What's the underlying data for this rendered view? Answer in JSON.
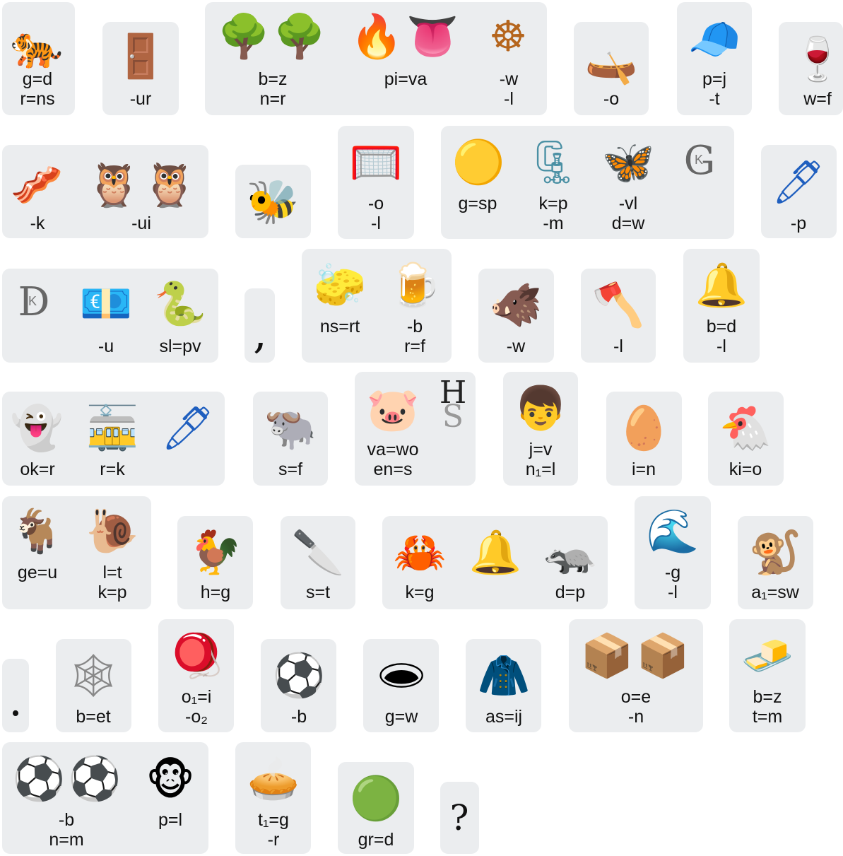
{
  "tiles": [
    {
      "glyphs": [
        {
          "icon": "tiger-icon",
          "char": "🐅"
        }
      ],
      "labels": [
        "g=d",
        "r=ns"
      ]
    },
    {
      "glyphs": [
        {
          "icon": "door-icon",
          "char": "🚪"
        }
      ],
      "labels": [
        "-ur"
      ]
    },
    {
      "glyphs": [
        {
          "icon": "tree-icon",
          "char": "🌳"
        },
        {
          "icon": "tree-icon",
          "char": "🌳"
        }
      ],
      "labels": [
        "b=z",
        "n=r"
      ]
    },
    {
      "glyphs": [
        {
          "icon": "fire-icon",
          "char": "🔥"
        },
        {
          "icon": "tongue-icon",
          "char": "👅"
        }
      ],
      "labels": [
        "pi=va"
      ]
    },
    {
      "glyphs": [
        {
          "icon": "wheel-icon",
          "char": "☸"
        }
      ],
      "labels": [
        "-w",
        "-l"
      ]
    },
    {
      "glyphs": [
        {
          "icon": "canoe-icon",
          "char": "🛶"
        }
      ],
      "labels": [
        "-o"
      ]
    },
    {
      "glyphs": [
        {
          "icon": "cap-icon",
          "char": "🧢"
        }
      ],
      "labels": [
        "p=j",
        "-t"
      ]
    },
    {
      "glyphs": [
        {
          "icon": "wine-glass-icon",
          "char": "🍷"
        }
      ],
      "labels": [
        "w=f"
      ]
    },
    {
      "glyphs": [
        {
          "icon": "bacon-icon",
          "char": "🥓"
        }
      ],
      "labels": [
        "-k"
      ]
    },
    {
      "glyphs": [
        {
          "icon": "owl-icon",
          "char": "🦉"
        },
        {
          "icon": "owl-icon",
          "char": "🦉"
        }
      ],
      "labels": [
        "-ui"
      ]
    },
    {
      "glyphs": [
        {
          "icon": "bee-icon",
          "char": "🐝"
        }
      ],
      "labels": []
    },
    {
      "glyphs": [
        {
          "icon": "goal-net-icon",
          "char": "🥅"
        }
      ],
      "labels": [
        "-o",
        "-l"
      ]
    },
    {
      "glyphs": [
        {
          "icon": "yellow-circle-icon",
          "char": "🟡"
        }
      ],
      "labels": [
        "g=sp"
      ]
    },
    {
      "glyphs": [
        {
          "icon": "clamp-icon",
          "char": "🗜"
        }
      ],
      "labels": [
        "k=p",
        "-m"
      ]
    },
    {
      "glyphs": [
        {
          "icon": "butterfly-icon",
          "char": "🦋"
        }
      ],
      "labels": [
        "-vl",
        "d=w"
      ]
    },
    {
      "glyphs": [
        {
          "icon": "letter-g-icon",
          "char": "G",
          "sub": "K"
        }
      ],
      "labels": []
    },
    {
      "glyphs": [
        {
          "icon": "pen-icon",
          "char": "🖊"
        }
      ],
      "labels": [
        "-p"
      ]
    },
    {
      "glyphs": [
        {
          "icon": "letter-d-icon",
          "char": "D",
          "sub": "K"
        }
      ],
      "labels": []
    },
    {
      "glyphs": [
        {
          "icon": "euro-banknote-icon",
          "char": "💶"
        }
      ],
      "labels": [
        "-u"
      ]
    },
    {
      "glyphs": [
        {
          "icon": "snake-icon",
          "char": "🐍"
        }
      ],
      "labels": [
        "sl=pv"
      ]
    },
    {
      "glyphs": [
        {
          "icon": "comma-icon",
          "char": ","
        }
      ],
      "labels": []
    },
    {
      "glyphs": [
        {
          "icon": "sponge-icon",
          "char": "🧽"
        }
      ],
      "labels": [
        "ns=rt"
      ]
    },
    {
      "glyphs": [
        {
          "icon": "beer-mug-icon",
          "char": "🍺"
        }
      ],
      "labels": [
        "-b",
        "r=f"
      ]
    },
    {
      "glyphs": [
        {
          "icon": "boar-icon",
          "char": "🐗"
        }
      ],
      "labels": [
        "-w"
      ]
    },
    {
      "glyphs": [
        {
          "icon": "axe-icon",
          "char": "🪓"
        }
      ],
      "labels": [
        "-l"
      ]
    },
    {
      "glyphs": [
        {
          "icon": "bell-icon",
          "char": "🔔"
        }
      ],
      "labels": [
        "b=d",
        "-l"
      ]
    },
    {
      "glyphs": [
        {
          "icon": "ghost-icon",
          "char": "👻"
        }
      ],
      "labels": [
        "ok=r"
      ]
    },
    {
      "glyphs": [
        {
          "icon": "tram-icon",
          "char": "🚋"
        }
      ],
      "labels": [
        "r=k"
      ]
    },
    {
      "glyphs": [
        {
          "icon": "pen-icon",
          "char": "🖊"
        }
      ],
      "labels": []
    },
    {
      "glyphs": [
        {
          "icon": "water-buffalo-icon",
          "char": "🐃"
        }
      ],
      "labels": [
        "s=f"
      ]
    },
    {
      "glyphs": [
        {
          "icon": "pig-face-icon",
          "char": "🐷"
        }
      ],
      "labels": [
        "va=wo",
        "en=s"
      ]
    },
    {
      "glyphs": [
        {
          "icon": "letters-h-s-icon",
          "char": "H",
          "sub": "S"
        }
      ],
      "labels": []
    },
    {
      "glyphs": [
        {
          "icon": "boy-icon",
          "char": "👦"
        }
      ],
      "labels": [
        "j=v",
        "n₁=l"
      ]
    },
    {
      "glyphs": [
        {
          "icon": "egg-icon",
          "char": "🥚"
        }
      ],
      "labels": [
        "i=n"
      ]
    },
    {
      "glyphs": [
        {
          "icon": "chicken-icon",
          "char": "🐔"
        }
      ],
      "labels": [
        "ki=o"
      ]
    },
    {
      "glyphs": [
        {
          "icon": "goat-icon",
          "char": "🐐"
        }
      ],
      "labels": [
        "ge=u"
      ]
    },
    {
      "glyphs": [
        {
          "icon": "snail-icon",
          "char": "🐌"
        }
      ],
      "labels": [
        "l=t",
        "k=p"
      ]
    },
    {
      "glyphs": [
        {
          "icon": "rooster-icon",
          "char": "🐓"
        }
      ],
      "labels": [
        "h=g"
      ]
    },
    {
      "glyphs": [
        {
          "icon": "kitchen-knife-icon",
          "char": "🔪"
        }
      ],
      "labels": [
        "s=t"
      ]
    },
    {
      "glyphs": [
        {
          "icon": "crab-icon",
          "char": "🦀"
        }
      ],
      "labels": [
        "k=g"
      ]
    },
    {
      "glyphs": [
        {
          "icon": "bell-icon",
          "char": "🔔"
        }
      ],
      "labels": []
    },
    {
      "glyphs": [
        {
          "icon": "badger-icon",
          "char": "🦡"
        }
      ],
      "labels": [
        "d=p"
      ]
    },
    {
      "glyphs": [
        {
          "icon": "wave-icon",
          "char": "🌊"
        }
      ],
      "labels": [
        "-g",
        "-l"
      ]
    },
    {
      "glyphs": [
        {
          "icon": "monkey-icon",
          "char": "🐒"
        }
      ],
      "labels": [
        "a₁=sw"
      ]
    },
    {
      "glyphs": [
        {
          "icon": "period-icon",
          "char": "."
        }
      ],
      "labels": []
    },
    {
      "glyphs": [
        {
          "icon": "spider-web-icon",
          "char": "🕸"
        }
      ],
      "labels": [
        "b=et"
      ]
    },
    {
      "glyphs": [
        {
          "icon": "yo-yo-icon",
          "char": "🪀"
        }
      ],
      "labels": [
        "o₁=i",
        "-o₂"
      ]
    },
    {
      "glyphs": [
        {
          "icon": "soccer-ball-icon",
          "char": "⚽"
        }
      ],
      "labels": [
        "-b"
      ]
    },
    {
      "glyphs": [
        {
          "icon": "hole-icon",
          "char": "🕳"
        }
      ],
      "labels": [
        "g=w"
      ]
    },
    {
      "glyphs": [
        {
          "icon": "coat-icon",
          "char": "🧥"
        }
      ],
      "labels": [
        "as=ij"
      ]
    },
    {
      "glyphs": [
        {
          "icon": "package-icon",
          "char": "📦"
        },
        {
          "icon": "package-icon",
          "char": "📦"
        }
      ],
      "labels": [
        "o=e",
        "-n"
      ]
    },
    {
      "glyphs": [
        {
          "icon": "butter-icon",
          "char": "🧈"
        }
      ],
      "labels": [
        "b=z",
        "t=m"
      ]
    },
    {
      "glyphs": [
        {
          "icon": "soccer-ball-icon",
          "char": "⚽"
        },
        {
          "icon": "soccer-ball-icon",
          "char": "⚽"
        }
      ],
      "labels": [
        "-b",
        "n=m"
      ]
    },
    {
      "glyphs": [
        {
          "icon": "monkey-face-icon",
          "char": "🐵"
        }
      ],
      "labels": [
        "p=l"
      ]
    },
    {
      "glyphs": [
        {
          "icon": "pie-icon",
          "char": "🥧"
        }
      ],
      "labels": [
        "t₁=g",
        "-r"
      ]
    },
    {
      "glyphs": [
        {
          "icon": "green-circle-icon",
          "char": "🟢"
        }
      ],
      "labels": [
        "gr=d"
      ]
    },
    {
      "glyphs": [
        {
          "icon": "question-mark-icon",
          "char": "?"
        }
      ],
      "labels": []
    }
  ]
}
